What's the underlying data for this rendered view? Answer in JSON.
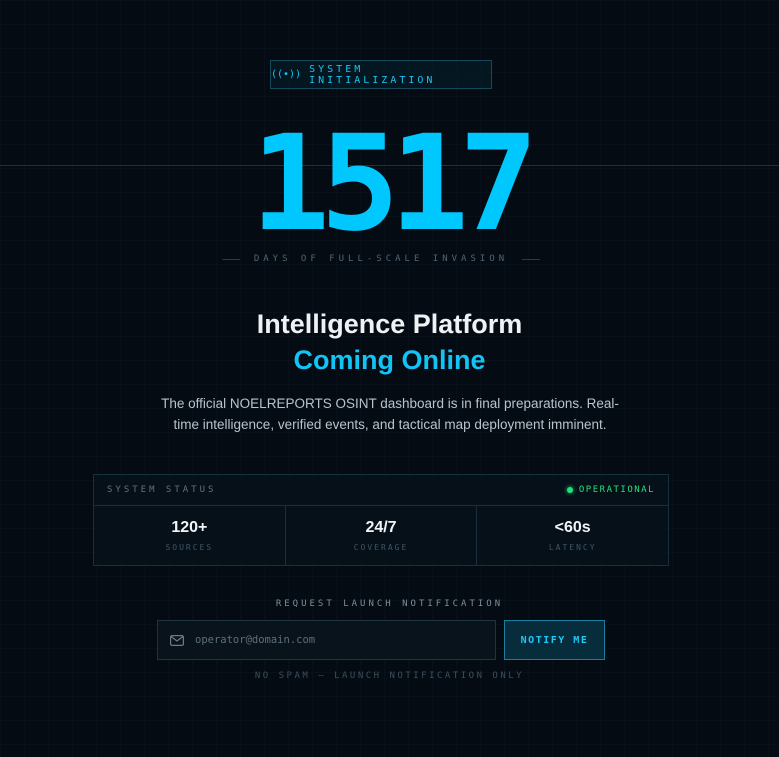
{
  "badge": {
    "icon": "broadcast-icon",
    "icon_glyph": "((•))",
    "label": "SYSTEM INITIALIZATION"
  },
  "counter": {
    "value": "1517",
    "caption": "DAYS OF FULL-SCALE INVASION"
  },
  "headline": {
    "title": "Intelligence Platform",
    "subtitle": "Coming Online"
  },
  "description": "The official NOELREPORTS OSINT dashboard is in final preparations. Real-time intelligence, verified events, and tactical map deployment imminent.",
  "status": {
    "label": "SYSTEM STATUS",
    "state": "OPERATIONAL",
    "metrics": [
      {
        "value": "120+",
        "label": "SOURCES"
      },
      {
        "value": "24/7",
        "label": "COVERAGE"
      },
      {
        "value": "<60s",
        "label": "LATENCY"
      }
    ]
  },
  "notify": {
    "label": "REQUEST LAUNCH NOTIFICATION",
    "placeholder": "operator@domain.com",
    "button": "NOTIFY ME",
    "fine_print": "NO SPAM — LAUNCH NOTIFICATION ONLY"
  },
  "colors": {
    "accent": "#00c8ff",
    "operational": "#22e07a",
    "background": "#050b12"
  }
}
